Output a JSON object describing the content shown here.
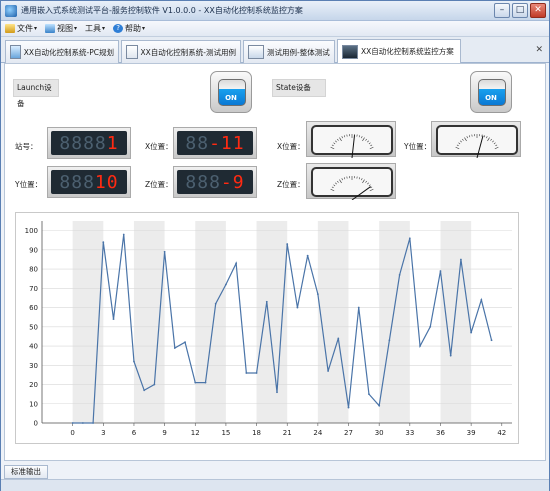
{
  "window": {
    "title": "通用嵌入式系统测试平台-服务控制软件 V1.0.0.0  - XX自动化控制系统监控方案"
  },
  "menu": [
    {
      "label": "文件",
      "icon": "file-icon"
    },
    {
      "label": "视图",
      "icon": "view-icon"
    },
    {
      "label": "工具",
      "icon": ""
    },
    {
      "label": "帮助",
      "icon": "help-icon"
    }
  ],
  "tabs": [
    {
      "label": "XX自动化控制系统-PC规划",
      "icon": "monitor-icon",
      "active": false
    },
    {
      "label": "XX自动化控制系统-测试用例",
      "icon": "document-icon",
      "active": false
    },
    {
      "label": "测试用例-整体测试",
      "icon": "list-icon",
      "active": false
    },
    {
      "label": "XX自动化控制系统监控方案",
      "icon": "screen-icon",
      "active": true
    }
  ],
  "panel": {
    "launch_label": "Launch设备",
    "state_label": "State设备",
    "launch_toggle": "ON",
    "state_toggle": "ON",
    "station_label": "站号：",
    "station_value": "1",
    "y_label_left": "Y位置：",
    "y_value_left": "10",
    "x_label_mid": "X位置：",
    "x_value_mid": "-11",
    "z_label_mid": "Z位置：",
    "z_value_mid": "-9",
    "x_label_right": "X位置：",
    "y_label_right": "Y位置：",
    "z_label_right": "Z位置："
  },
  "gauges": {
    "x_position": 0.55,
    "y_position": 0.62,
    "z_position": 0.93
  },
  "chart_data": {
    "type": "line",
    "x": [
      0,
      1,
      2,
      3,
      4,
      5,
      6,
      7,
      8,
      9,
      10,
      11,
      12,
      13,
      14,
      15,
      16,
      17,
      18,
      19,
      20,
      21,
      22,
      23,
      24,
      25,
      26,
      27,
      28,
      29,
      30,
      31,
      32,
      33,
      34,
      35,
      36,
      37,
      38,
      39,
      40,
      41
    ],
    "values": [
      0,
      0,
      0,
      94,
      54,
      98,
      32,
      17,
      20,
      89,
      39,
      42,
      21,
      21,
      62,
      72,
      83,
      26,
      26,
      63,
      16,
      93,
      60,
      87,
      67,
      27,
      44,
      8,
      60,
      15,
      9,
      43,
      77,
      96,
      40,
      50,
      79,
      35,
      85,
      47,
      64,
      43
    ],
    "xticks": [
      "0",
      "3",
      "6",
      "9",
      "12",
      "15",
      "18",
      "21",
      "24",
      "27",
      "30",
      "33",
      "36",
      "39",
      "42"
    ],
    "yticks": [
      "0",
      "10",
      "20",
      "30",
      "40",
      "50",
      "60",
      "70",
      "80",
      "90",
      "100"
    ],
    "xlim": [
      -3,
      43
    ],
    "ylim": [
      0,
      105
    ],
    "line_color": "#4a74a8",
    "band_color": "#ececec"
  },
  "bottom": {
    "tab_label": "标准输出"
  }
}
